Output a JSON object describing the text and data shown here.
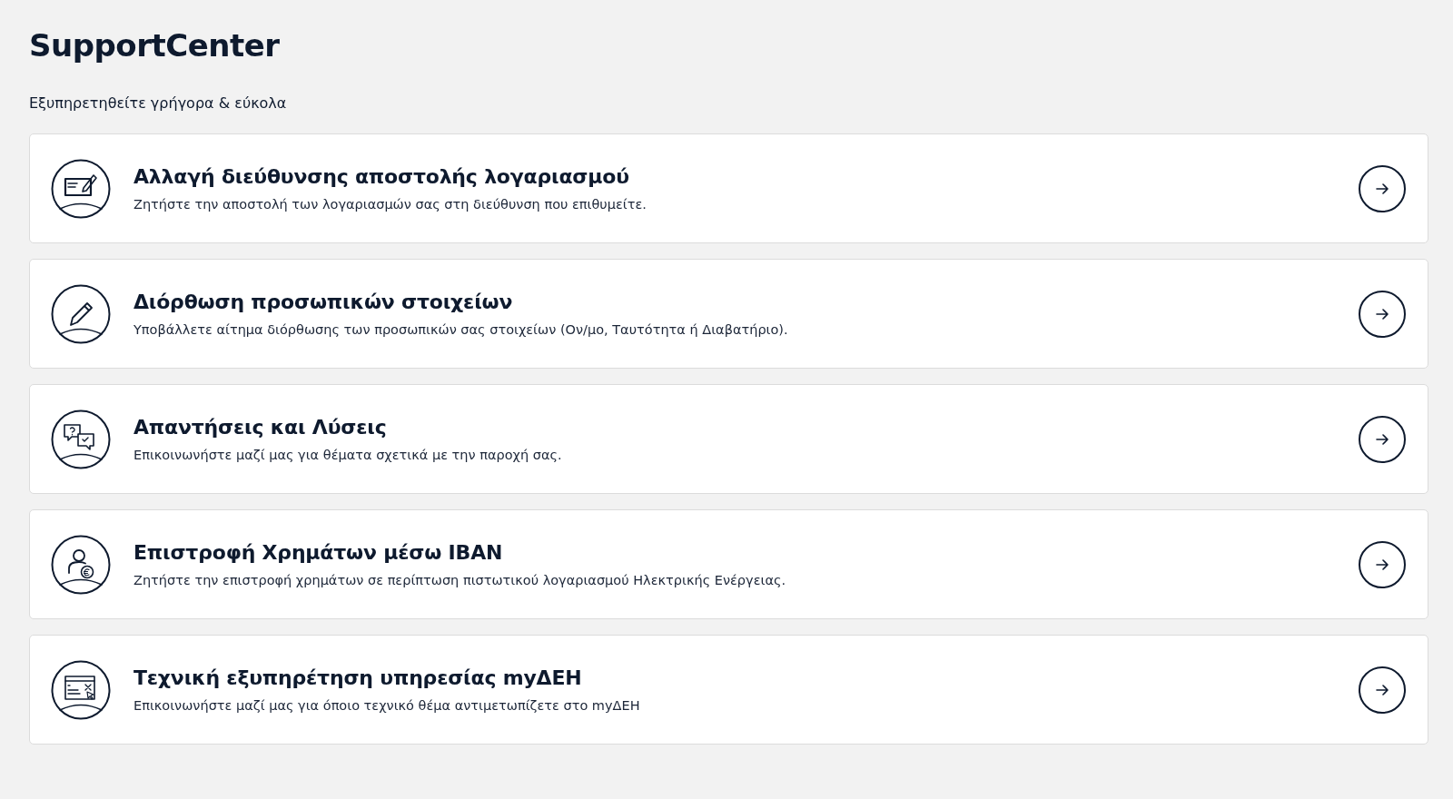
{
  "header": {
    "title": "SupportCenter",
    "subtitle": "Εξυπηρετηθείτε γρήγορα & εύκολα"
  },
  "services": [
    {
      "kind": "address",
      "title": "Αλλαγή διεύθυνσης αποστολής λογαριασμού",
      "description": "Ζητήστε την αποστολή των λογαριασμών σας στη διεύθυνση που επιθυμείτε."
    },
    {
      "kind": "edit",
      "title": "Διόρθωση προσωπικών στοιχείων",
      "description": "Υποβάλλετε αίτημα διόρθωσης των προσωπικών σας στοιχείων (Ον/μο, Ταυτότητα ή Διαβατήριο)."
    },
    {
      "kind": "faq",
      "title": "Απαντήσεις και Λύσεις",
      "description": "Επικοινωνήστε μαζί μας για θέματα σχετικά με την παροχή σας."
    },
    {
      "kind": "refund",
      "title": "Επιστροφή Χρημάτων μέσω IBAN",
      "description": "Ζητήστε την επιστροφή χρημάτων σε περίπτωση πιστωτικού λογαριασμού Ηλεκτρικής Ενέργειας."
    },
    {
      "kind": "tech",
      "title": "Τεχνική εξυπηρέτηση υπηρεσίας myΔΕΗ",
      "description": "Επικοινωνήστε μαζί μας για όποιο τεχνικό θέμα αντιμετωπίζετε στο myΔΕΗ"
    }
  ]
}
